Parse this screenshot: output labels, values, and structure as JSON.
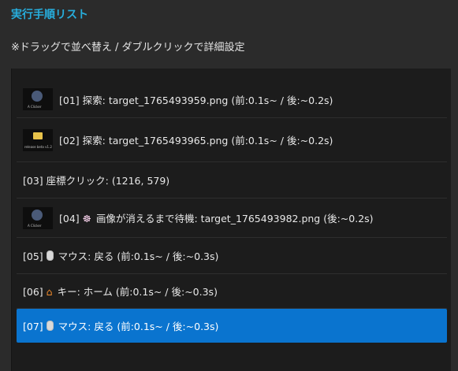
{
  "header": {
    "title": "実行手順リスト",
    "hint": "※ドラッグで並べ替え / ダブルクリックで詳細設定"
  },
  "steps": [
    {
      "label": "[01] 探索: target_1765493959.png (前:0.1s~ / 後:~0.2s)",
      "thumb": "target",
      "thumb_caption": "A Clicker"
    },
    {
      "label": "[02] 探索: target_1765493965.png (前:0.1s~ / 後:~0.2s)",
      "thumb": "folder",
      "thumb_caption": "release beta v1.2"
    },
    {
      "label": "[03] 座標クリック: (1216, 579)"
    },
    {
      "label": "画像が消えるまで待機: target_1765493982.png (後:~0.2s)",
      "prefix": "[04]",
      "thumb": "target",
      "thumb_caption": "A Clicker",
      "icon": "ghost-icon"
    },
    {
      "label": "マウス: 戻る (前:0.1s~ / 後:~0.3s)",
      "prefix": "[05]",
      "icon": "mouse-icon"
    },
    {
      "label": "キー: ホーム (前:0.1s~ / 後:~0.3s)",
      "prefix": "[06]",
      "icon": "house-icon"
    },
    {
      "label": "マウス: 戻る (前:0.1s~ / 後:~0.3s)",
      "prefix": "[07]",
      "icon": "mouse-icon",
      "selected": true
    }
  ],
  "colors": {
    "title": "#27aedd",
    "selection": "#0a74cf",
    "list_bg": "#1c1c1c",
    "page_bg": "#2b2b2b"
  }
}
